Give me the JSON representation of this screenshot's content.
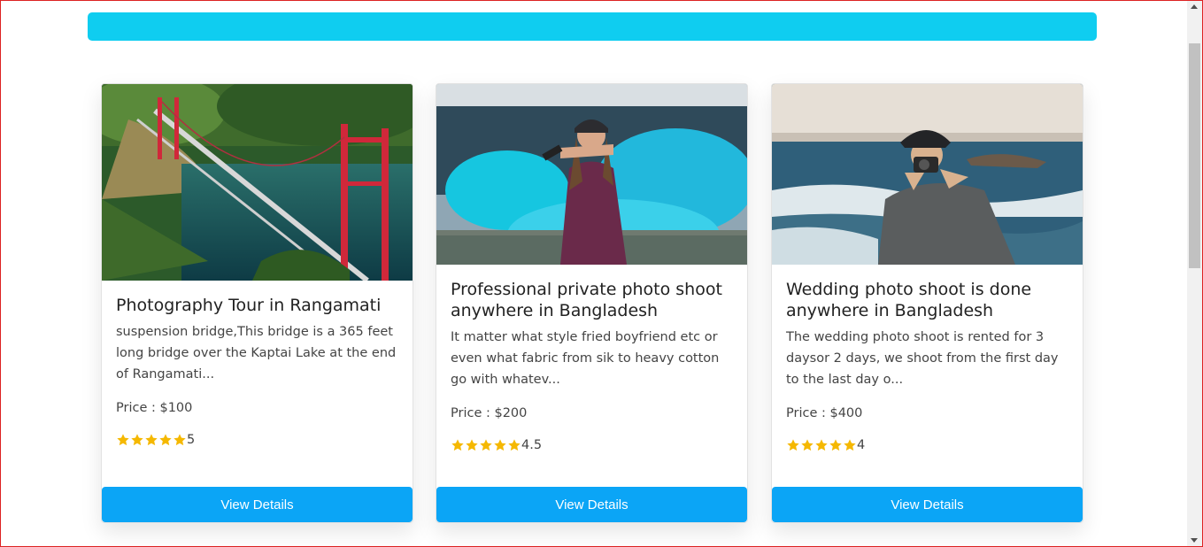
{
  "colors": {
    "top_bar": "#0fcdf0",
    "button": "#0ba5f6",
    "star": "#f5b800"
  },
  "cards": [
    {
      "image": "suspension-bridge-photo",
      "title": "Photography Tour in Rangamati",
      "description": "suspension bridge,This bridge is a 365 feet long bridge over the Kaptai Lake at the end of Rangamati...",
      "price": "Price : $100",
      "stars": 5,
      "rating": "5",
      "button": "View Details"
    },
    {
      "image": "blue-smoke-photo",
      "title": "Professional private photo shoot anywhere in Bangladesh",
      "description": "It matter what style fried boyfriend etc or even what fabric from sik to heavy cotton go with whatev...",
      "price": "Price : $200",
      "stars": 5,
      "rating": "4.5",
      "button": "View Details"
    },
    {
      "image": "photographer-sea-photo",
      "title": "Wedding photo shoot is done anywhere in Bangladesh",
      "description": "The wedding photo shoot is rented for 3 daysor 2 days, we shoot from the first day to the last day o...",
      "price": "Price : $400",
      "stars": 5,
      "rating": "4",
      "button": "View Details"
    }
  ]
}
